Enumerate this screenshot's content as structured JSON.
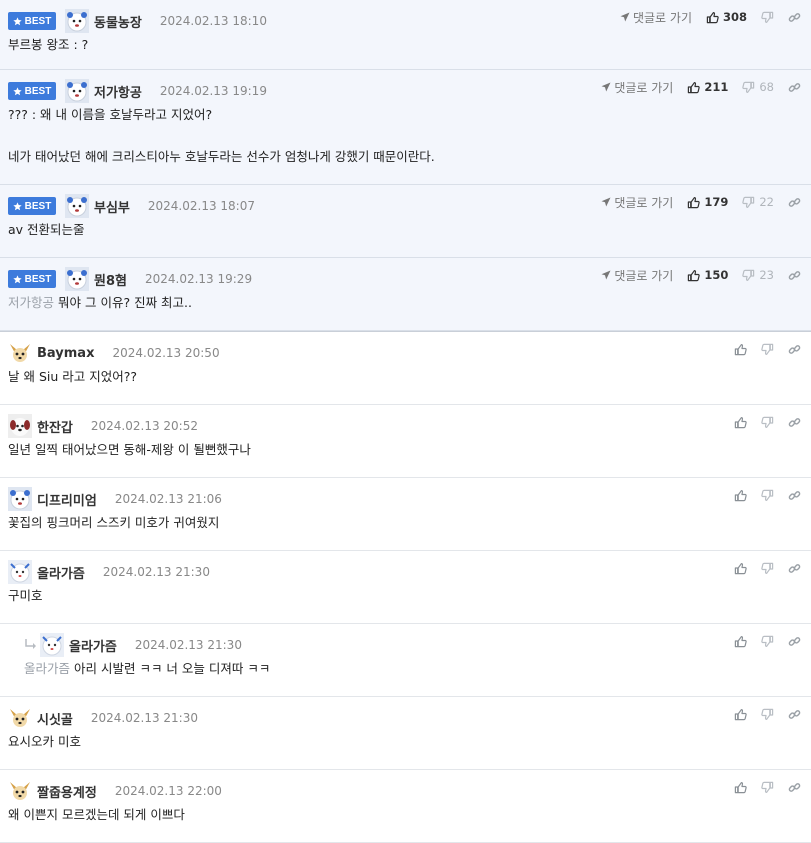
{
  "labels": {
    "best": "BEST",
    "goto": "댓글로 가기"
  },
  "best_comments": [
    {
      "nick": "동물농장",
      "time": "2024.02.13 18:10",
      "up": "308",
      "down": "",
      "mention": "",
      "lines": [
        "부르봉 왕조 : ?"
      ],
      "avatar": "bear-avatar"
    },
    {
      "nick": "저가항공",
      "time": "2024.02.13 19:19",
      "up": "211",
      "down": "68",
      "mention": "",
      "lines": [
        "??? : 왜 내 이름을 호날두라고 지었어?",
        "",
        "네가 태어났던 해에 크리스티아누 호날두라는 선수가 엄청나게 강했기 때문이란다."
      ],
      "avatar": "bear-avatar"
    },
    {
      "nick": "부심부",
      "time": "2024.02.13 18:07",
      "up": "179",
      "down": "22",
      "mention": "",
      "lines": [
        "av 전환되는줄"
      ],
      "avatar": "bear-avatar"
    },
    {
      "nick": "뭔8혐",
      "time": "2024.02.13 19:29",
      "up": "150",
      "down": "23",
      "mention": "저가항공",
      "lines": [
        "뭐야 그 이유? 진짜 최고.."
      ],
      "avatar": "bear-avatar"
    }
  ],
  "comments": [
    {
      "nick": "Baymax",
      "time": "2024.02.13 20:50",
      "mention": "",
      "lines": [
        "날 왜 Siu 라고 지었어??"
      ],
      "avatar": "dog-avatar",
      "reply": false
    },
    {
      "nick": "한잔갑",
      "time": "2024.02.13 20:52",
      "mention": "",
      "lines": [
        "일년 일찍 태어났으면 동해-제왕 이 될뻔했구나"
      ],
      "avatar": "puppy-avatar",
      "reply": false
    },
    {
      "nick": "디프리미엄",
      "time": "2024.02.13 21:06",
      "mention": "",
      "lines": [
        "꽃집의 핑크머리 스즈키 미호가 귀여웠지"
      ],
      "avatar": "bear-avatar",
      "reply": false
    },
    {
      "nick": "올라가즘",
      "time": "2024.02.13 21:30",
      "mention": "",
      "lines": [
        "구미호"
      ],
      "avatar": "seal-avatar",
      "reply": false
    },
    {
      "nick": "올라가즘",
      "time": "2024.02.13 21:30",
      "mention": "올라가즘",
      "lines": [
        "아리 시발련 ㅋㅋ 너 오늘 디져따 ㅋㅋ"
      ],
      "avatar": "seal-avatar",
      "reply": true
    },
    {
      "nick": "시싯골",
      "time": "2024.02.13 21:30",
      "mention": "",
      "lines": [
        "요시오카 미호"
      ],
      "avatar": "dog-avatar",
      "reply": false
    },
    {
      "nick": "짤줍용계정",
      "time": "2024.02.13 22:00",
      "mention": "",
      "lines": [
        "왜 이쁜지 모르겠는데 되게 이쁘다"
      ],
      "avatar": "dog-avatar",
      "reply": false
    }
  ]
}
